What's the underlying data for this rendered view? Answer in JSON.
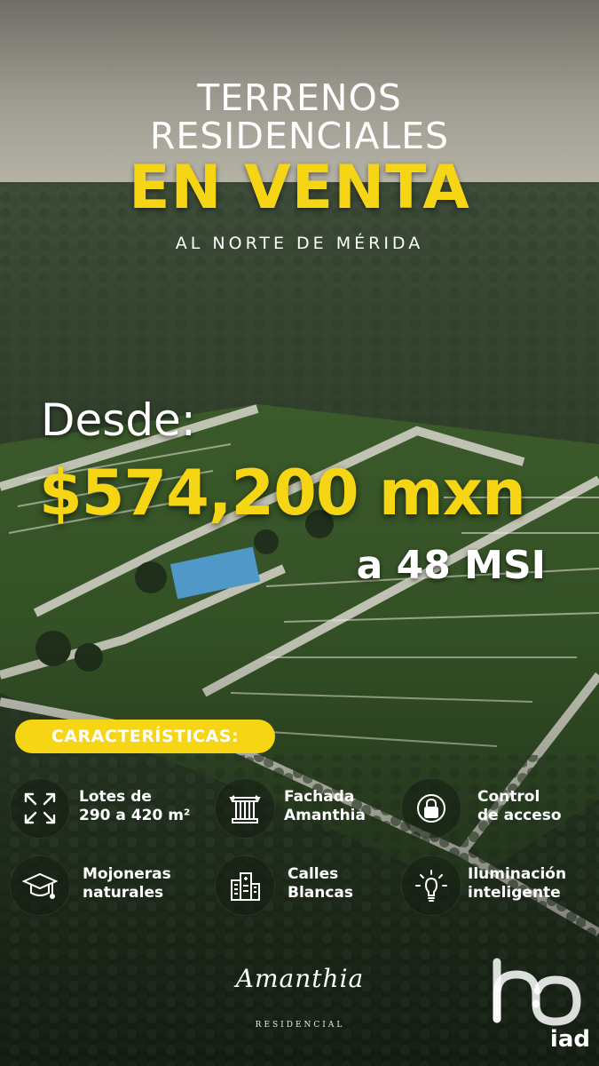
{
  "header": {
    "line1": "TERRENOS",
    "line2": "RESIDENCIALES",
    "line3": "EN VENTA",
    "subtitle": "AL NORTE DE MÉRIDA"
  },
  "pricing": {
    "from_label": "Desde:",
    "price": "$574,200 mxn",
    "installments": "a 48 MSI"
  },
  "features": {
    "heading": "CARACTERÍSTICAS:",
    "items": [
      {
        "icon": "expand-arrows-icon",
        "line1": "Lotes de",
        "line2": "290 a 420 m²"
      },
      {
        "icon": "column-icon",
        "line1": "Fachada",
        "line2": "Amanthia"
      },
      {
        "icon": "lock-icon",
        "line1": "Control",
        "line2": "de acceso"
      },
      {
        "icon": "graduation-cap-icon",
        "line1": "Mojoneras",
        "line2": "naturales"
      },
      {
        "icon": "building-icon",
        "line1": "Calles",
        "line2": "Blancas"
      },
      {
        "icon": "lightbulb-icon",
        "line1": "Iluminación",
        "line2": "inteligente"
      }
    ]
  },
  "branding": {
    "logo_script": "Amanthia",
    "logo_sub": "RESIDENCIAL",
    "agency": "iad"
  },
  "colors": {
    "accent": "#f6d515",
    "text": "#ffffff"
  }
}
